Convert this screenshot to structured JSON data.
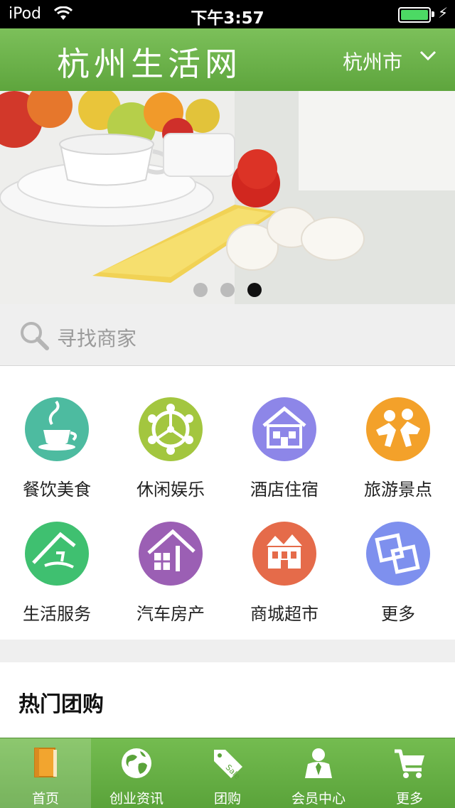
{
  "status": {
    "carrier": "iPod",
    "time": "下午3:57"
  },
  "header": {
    "title": "杭州生活网",
    "city": "杭州市"
  },
  "banner": {
    "slides": 3,
    "active_slide": 3
  },
  "search": {
    "placeholder": "寻找商家"
  },
  "categories": [
    {
      "label": "餐饮美食",
      "icon": "coffee-cup-icon",
      "color": "#4dbba0"
    },
    {
      "label": "休闲娱乐",
      "icon": "wheel-icon",
      "color": "#a3c63f"
    },
    {
      "label": "酒店住宿",
      "icon": "hotel-house-icon",
      "color": "#8d86e8"
    },
    {
      "label": "旅游景点",
      "icon": "travel-people-icon",
      "color": "#f3a12a"
    },
    {
      "label": "生活服务",
      "icon": "life-service-icon",
      "color": "#3fc070"
    },
    {
      "label": "汽车房产",
      "icon": "house-icon",
      "color": "#9b5fb4"
    },
    {
      "label": "商城超市",
      "icon": "shop-building-icon",
      "color": "#e56b4a"
    },
    {
      "label": "更多",
      "icon": "more-squares-icon",
      "color": "#7e90ee"
    }
  ],
  "hot": {
    "title": "热门团购"
  },
  "tabs": [
    {
      "label": "首页",
      "icon": "book-icon",
      "active": true
    },
    {
      "label": "创业资讯",
      "icon": "globe-icon",
      "active": false
    },
    {
      "label": "团购",
      "icon": "sale-tag-icon",
      "active": false
    },
    {
      "label": "会员中心",
      "icon": "member-icon",
      "active": false
    },
    {
      "label": "更多",
      "icon": "cart-icon",
      "active": false
    }
  ]
}
